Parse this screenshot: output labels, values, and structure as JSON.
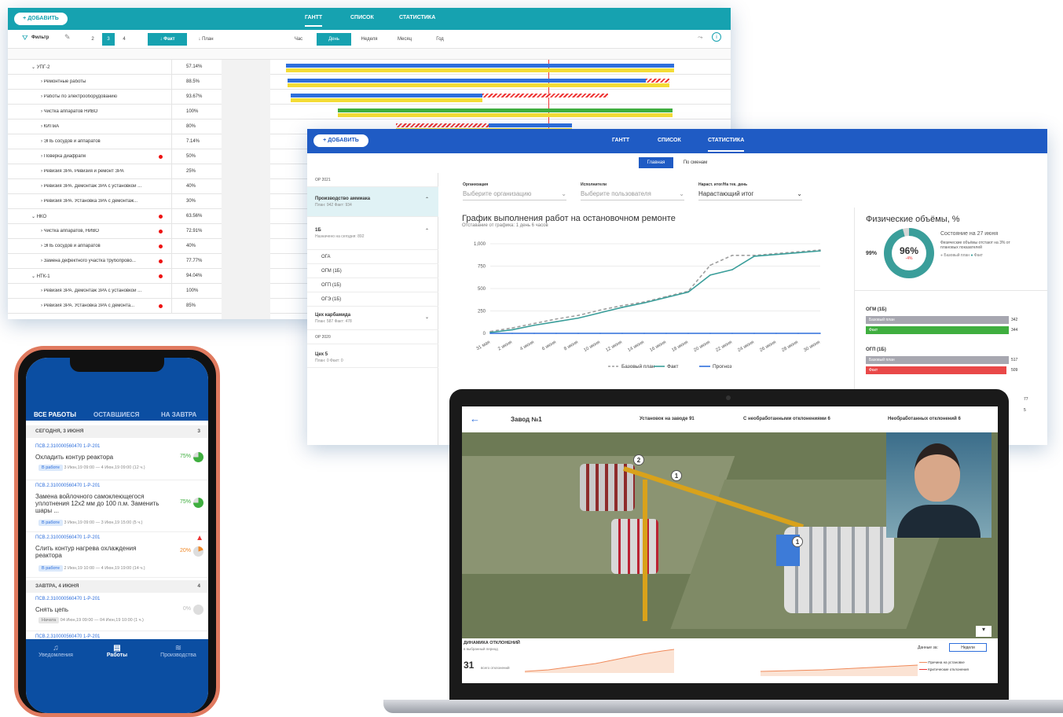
{
  "gantt": {
    "add_button": "+ ДОБАВИТЬ",
    "tabs": [
      "ГАНТТ",
      "СПИСОК",
      "СТАТИСТИКА"
    ],
    "filter_label": "Фильтр",
    "levels": [
      "2",
      "3",
      "4"
    ],
    "fact_button": "Факт",
    "plan_button": "План",
    "scales": [
      "Час",
      "День",
      "Неделя",
      "Месяц",
      "Год"
    ],
    "rows": [
      {
        "name": "УПГ-2",
        "percent": "57.14%",
        "group": true,
        "flag": false
      },
      {
        "name": "Ремонтные работы",
        "percent": "88.5%",
        "group": false,
        "flag": false
      },
      {
        "name": "Работы по электрооборудованию",
        "percent": "93.67%",
        "group": false,
        "flag": false
      },
      {
        "name": "Чистка аппаратов НИВО",
        "percent": "100%",
        "group": false,
        "flag": false
      },
      {
        "name": "КИПиА",
        "percent": "80%",
        "group": false,
        "flag": false
      },
      {
        "name": "ЭПБ сосудов и аппаратов",
        "percent": "7.14%",
        "group": false,
        "flag": false
      },
      {
        "name": "Поверка диафрагм",
        "percent": "50%",
        "group": false,
        "flag": true
      },
      {
        "name": "Ревизия ЗРА. Ревизия и ремонт ЗРА",
        "percent": "25%",
        "group": false,
        "flag": false
      },
      {
        "name": "Ревизия ЗРА. Демонтаж ЗРА с установкой ...",
        "percent": "40%",
        "group": false,
        "flag": false
      },
      {
        "name": "Ревизия ЗРА. Установка ЗРА с демонтаж...",
        "percent": "30%",
        "group": false,
        "flag": false
      },
      {
        "name": "НКО",
        "percent": "63.56%",
        "group": true,
        "flag": true
      },
      {
        "name": "Чистка аппаратов, НИВО",
        "percent": "72.91%",
        "group": false,
        "flag": true
      },
      {
        "name": "ЭПБ сосудов и аппаратов",
        "percent": "40%",
        "group": false,
        "flag": true
      },
      {
        "name": "Замена дефектного участка трубопрово...",
        "percent": "77.77%",
        "group": false,
        "flag": true
      },
      {
        "name": "НТК-1",
        "percent": "94.04%",
        "group": true,
        "flag": true
      },
      {
        "name": "Ревизия ЗРА. Демонтаж ЗРА с установкой ...",
        "percent": "100%",
        "group": false,
        "flag": false
      },
      {
        "name": "Ревизия ЗРА. Установка ЗРА с демонта...",
        "percent": "85%",
        "group": false,
        "flag": true
      }
    ]
  },
  "stats": {
    "add_button": "+ ДОБАВИТЬ",
    "tabs": [
      "ГАНТТ",
      "СПИСОК",
      "СТАТИСТИКА"
    ],
    "subtabs": [
      "Главная",
      "По сменам"
    ],
    "left": {
      "section1": "ОР 2021",
      "item1_title": "Производство аммиака",
      "item1_sub": "План: 942   Факт: 934",
      "item2_title": "1Б",
      "item2_sub": "Назначено на сегодня: 892",
      "subitems": [
        "ОГА",
        "ОГМ (1Б)",
        "ОГП (1Б)",
        "ОГЭ (1Б)"
      ],
      "item3_title": "Цех карбамида",
      "item3_sub": "План: 587   Факт: 478",
      "section2": "ОР 2020",
      "item4_title": "Цех 5",
      "item4_sub": "План: 0   Факт: 0"
    },
    "filters": [
      {
        "caption": "Организация",
        "value": "Выберите организацию"
      },
      {
        "caption": "Исполнители",
        "value": "Выберите пользователя"
      },
      {
        "caption": "Нараст. итог/На тек. день",
        "value": "Нарастающий итог"
      }
    ],
    "chart_title": "График выполнения работ на остановочном ремонте",
    "chart_subtitle": "Отставание от графика: 1 день 6 часов",
    "phys_title": "Физические объёмы, %",
    "phys_state": "Состояние на 27 июня",
    "phys_note": "Физические объёмы отстают на 3% от плановых показателей",
    "donut_value": "96%",
    "donut_delta": "-4%",
    "donut_plan": "99%",
    "donut_legend": [
      "Базовый план",
      "Факт"
    ],
    "hbars": [
      {
        "group": "ОГМ (1Б)",
        "plan_label": "Базовый план",
        "plan": "342",
        "fact_label": "Факт",
        "fact": "344"
      },
      {
        "group": "ОГП (1Б)",
        "plan_label": "Базовый план",
        "plan": "517",
        "fact_label": "Факт",
        "fact": "509"
      }
    ],
    "edge_numbers": [
      "77",
      "5"
    ]
  },
  "chart_data": {
    "type": "line",
    "title": "График выполнения работ на остановочном ремонте",
    "xlabel": "",
    "ylabel": "",
    "categories": [
      "31 мая",
      "2 июня",
      "4 июня",
      "6 июня",
      "8 июня",
      "10 июня",
      "12 июня",
      "14 июня",
      "16 июня",
      "18 июня",
      "20 июня",
      "22 июня",
      "24 июня",
      "26 июня",
      "28 июня",
      "30 июня"
    ],
    "yticks": [
      "0",
      "250",
      "500",
      "750",
      "1,000"
    ],
    "ylim": [
      0,
      1000
    ],
    "grid": true,
    "legend": "bottom",
    "series": [
      {
        "name": "Базовый план",
        "color": "#9e9e9e",
        "dash": true,
        "values": [
          20,
          60,
          110,
          160,
          200,
          260,
          310,
          350,
          410,
          470,
          760,
          870,
          870,
          890,
          910,
          930
        ]
      },
      {
        "name": "Факт",
        "color": "#3a9e9a",
        "dash": false,
        "values": [
          10,
          40,
          90,
          130,
          170,
          230,
          290,
          340,
          400,
          460,
          650,
          710,
          860,
          880,
          900,
          920
        ]
      },
      {
        "name": "Прогноз",
        "color": "#2e6fdc",
        "dash": false,
        "values": [
          0,
          0,
          0,
          0,
          0,
          0,
          0,
          0,
          0,
          0,
          0,
          0,
          0,
          0,
          0,
          0
        ]
      }
    ]
  },
  "phone": {
    "tabs": [
      "ВСЕ РАБОТЫ",
      "ОСТАВШИЕСЯ",
      "НА ЗАВТРА"
    ],
    "today_header": "СЕГОДНЯ, 3 ИЮНЯ",
    "today_count": "3",
    "items": [
      {
        "id": "ПСВ.2.310000560470 1-Р-201",
        "text": "Охладить контур реактора",
        "status": "В работе",
        "dates": "3 Июн,19  09:00 — 4 Июн,19  09:00  (12 ч.)",
        "pct": "75%"
      },
      {
        "id": "ПСВ.2.310000560470 1-Р-201",
        "text": "Замена войлочного самоклеющегося уплотнения 12х2 мм до 100 п.м. Заменить шары ...",
        "status": "В работе",
        "dates": "3 Июн,19  09:00 — 3 Июн,19  15:00  (5 ч.)",
        "pct": "75%"
      },
      {
        "id": "ПСВ.2.310000560470 1-Р-201",
        "text": "Слить контур нагрева охлаждения реактора",
        "status": "В работе",
        "dates": "2 Июн,19  10:00 — 4 Июн,19  19:00  (14 ч.)",
        "pct": "20%"
      }
    ],
    "tomorrow_header": "ЗАВТРА, 4 ИЮНЯ",
    "tomorrow_count": "4",
    "tomorrow_item": {
      "id": "ПСВ.2.310000560470 1-Р-201",
      "text": "Снять цепь",
      "status": "Начата",
      "dates": "04 Июн,19  09:00 — 04 Июн,19  10:00  (1 ч.)",
      "pct": "0%"
    },
    "cut_item_id": "ПСВ.2.310000560470 1-Р-201",
    "nav": [
      "Уведомления",
      "Работы",
      "Производства"
    ]
  },
  "laptop": {
    "title": "Завод №1",
    "installs": "Установок на заводе  91",
    "with_dev": "С необработанными отклонениями  6",
    "unprocessed": "Необработанных отклонений  6",
    "panel_title": "ДИНАМИКА ОТКЛОНЕНИЙ",
    "panel_sub": "в выбранный период",
    "panel_num": "31",
    "panel_num_caption": "всего отклонений",
    "data_for": "Данные за:",
    "period": "Недели",
    "legend": [
      "Причина на установке",
      "Критические отклонения"
    ],
    "markers": [
      "2",
      "1",
      "1"
    ]
  }
}
